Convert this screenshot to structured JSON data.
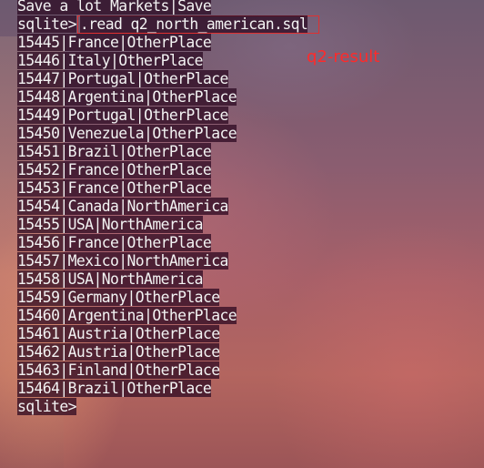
{
  "window": {
    "cropped_top_line": "Save a lot Markets|Save",
    "prompt": "sqlite>",
    "command": ".read q2_north_american.sql",
    "final_prompt": "sqlite>"
  },
  "annotation": {
    "label": "q2-result",
    "color": "#ff2a2a"
  },
  "result_rows": [
    {
      "id": "15445",
      "country": "France",
      "region": "OtherPlace"
    },
    {
      "id": "15446",
      "country": "Italy",
      "region": "OtherPlace"
    },
    {
      "id": "15447",
      "country": "Portugal",
      "region": "OtherPlace"
    },
    {
      "id": "15448",
      "country": "Argentina",
      "region": "OtherPlace"
    },
    {
      "id": "15449",
      "country": "Portugal",
      "region": "OtherPlace"
    },
    {
      "id": "15450",
      "country": "Venezuela",
      "region": "OtherPlace"
    },
    {
      "id": "15451",
      "country": "Brazil",
      "region": "OtherPlace"
    },
    {
      "id": "15452",
      "country": "France",
      "region": "OtherPlace"
    },
    {
      "id": "15453",
      "country": "France",
      "region": "OtherPlace"
    },
    {
      "id": "15454",
      "country": "Canada",
      "region": "NorthAmerica"
    },
    {
      "id": "15455",
      "country": "USA",
      "region": "NorthAmerica"
    },
    {
      "id": "15456",
      "country": "France",
      "region": "OtherPlace"
    },
    {
      "id": "15457",
      "country": "Mexico",
      "region": "NorthAmerica"
    },
    {
      "id": "15458",
      "country": "USA",
      "region": "NorthAmerica"
    },
    {
      "id": "15459",
      "country": "Germany",
      "region": "OtherPlace"
    },
    {
      "id": "15460",
      "country": "Argentina",
      "region": "OtherPlace"
    },
    {
      "id": "15461",
      "country": "Austria",
      "region": "OtherPlace"
    },
    {
      "id": "15462",
      "country": "Austria",
      "region": "OtherPlace"
    },
    {
      "id": "15463",
      "country": "Finland",
      "region": "OtherPlace"
    },
    {
      "id": "15464",
      "country": "Brazil",
      "region": "OtherPlace"
    }
  ],
  "colors": {
    "text": "#f3f3f3",
    "highlight": "#28061e",
    "command_box_border": "#e03030"
  }
}
